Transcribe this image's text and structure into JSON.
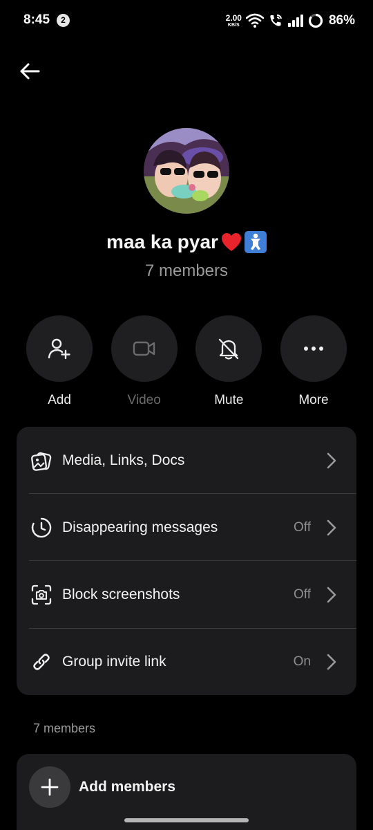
{
  "status_bar": {
    "time": "8:45",
    "notification_count": "2",
    "net_speed_value": "2.00",
    "net_speed_unit": "KB/S",
    "battery": "86%",
    "battery_level": 0.86
  },
  "header": {
    "back_icon": "arrow-left-icon"
  },
  "group": {
    "name": "maa ka pyar",
    "name_emojis": [
      "red-heart",
      "baby-symbol"
    ],
    "member_count_text": "7 members"
  },
  "actions": [
    {
      "label": "Add",
      "icon": "add-person-icon",
      "enabled": true
    },
    {
      "label": "Video",
      "icon": "video-camera-icon",
      "enabled": false
    },
    {
      "label": "Mute",
      "icon": "bell-off-icon",
      "enabled": true
    },
    {
      "label": "More",
      "icon": "more-dots-icon",
      "enabled": true
    }
  ],
  "settings": [
    {
      "label": "Media, Links, Docs",
      "value": "",
      "icon": "media-stack-icon"
    },
    {
      "label": "Disappearing messages",
      "value": "Off",
      "icon": "timer-icon"
    },
    {
      "label": "Block screenshots",
      "value": "Off",
      "icon": "screenshot-camera-icon"
    },
    {
      "label": "Group invite link",
      "value": "On",
      "icon": "link-icon"
    }
  ],
  "members_section": {
    "title": "7 members",
    "add_members_label": "Add members"
  },
  "colors": {
    "background": "#000000",
    "card": "#1c1c1e",
    "button_circle": "#1f1f21",
    "secondary_text": "#9a9a9a"
  }
}
